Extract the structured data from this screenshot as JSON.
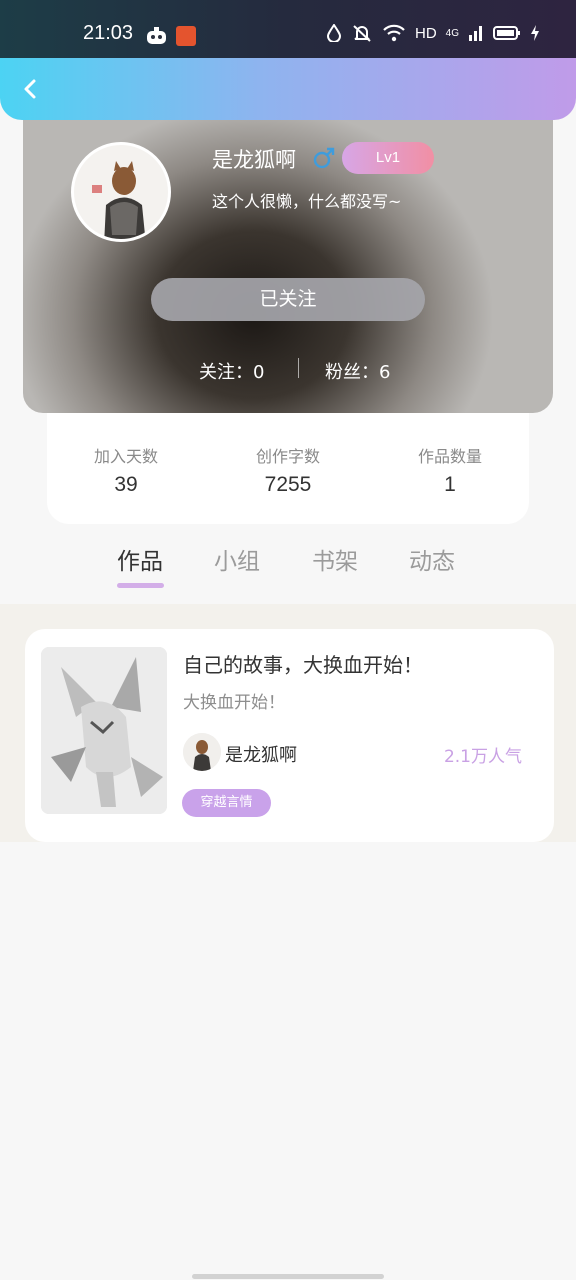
{
  "status_bar": {
    "time": "21:03",
    "network_label": "HD",
    "signal_label": "4G"
  },
  "profile": {
    "username": "是龙狐啊",
    "gender_symbol": "♂",
    "level": "Lv1",
    "bio": "这个人很懒，什么都没写~",
    "follow_button": "已关注",
    "following": "关注：0",
    "followers": "粉丝：6"
  },
  "stats": [
    {
      "label": "加入天数",
      "value": "39"
    },
    {
      "label": "创作字数",
      "value": "7255"
    },
    {
      "label": "作品数量",
      "value": "1"
    }
  ],
  "tabs": [
    {
      "label": "作品",
      "active": true
    },
    {
      "label": "小组",
      "active": false
    },
    {
      "label": "书架",
      "active": false
    },
    {
      "label": "动态",
      "active": false
    }
  ],
  "works": [
    {
      "title": "自己的故事，大换血开始！",
      "desc": "大换血开始！",
      "author": "是龙狐啊",
      "popularity": "2.1万人气",
      "tag": "穿越言情"
    }
  ],
  "colors": {
    "header_gradient": [
      "#4cd3f3",
      "#c09be9"
    ],
    "level_gradient": [
      "#d7a6e6",
      "#f18fa4"
    ],
    "accent": "#c9a2ea",
    "gender": "#3f9cdc"
  },
  "icons": {
    "back": "back-arrow-icon",
    "gender": "male-icon",
    "wifi": "wifi-icon",
    "battery": "battery-icon"
  }
}
